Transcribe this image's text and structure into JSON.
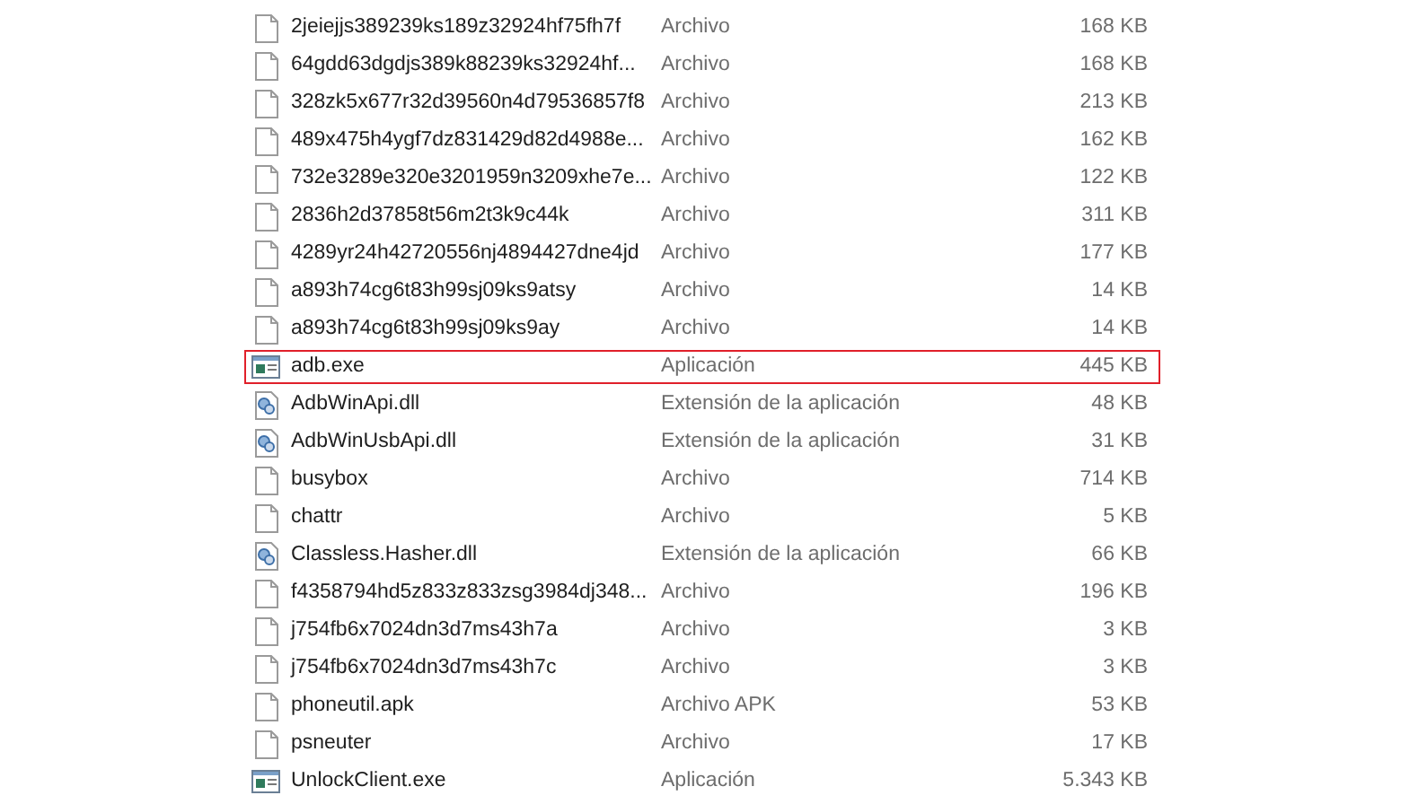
{
  "files": [
    {
      "name": "2jeiejjs389239ks189z32924hf75fh7f",
      "type": "Archivo",
      "size": "168 KB",
      "kind": "file",
      "outlined": false
    },
    {
      "name": "64gdd63dgdjs389k88239ks32924hf...",
      "type": "Archivo",
      "size": "168 KB",
      "kind": "file",
      "outlined": false
    },
    {
      "name": "328zk5x677r32d39560n4d79536857f8",
      "type": "Archivo",
      "size": "213 KB",
      "kind": "file",
      "outlined": false
    },
    {
      "name": "489x475h4ygf7dz831429d82d4988e...",
      "type": "Archivo",
      "size": "162 KB",
      "kind": "file",
      "outlined": false
    },
    {
      "name": "732e3289e320e3201959n3209xhe7e...",
      "type": "Archivo",
      "size": "122 KB",
      "kind": "file",
      "outlined": false
    },
    {
      "name": "2836h2d37858t56m2t3k9c44k",
      "type": "Archivo",
      "size": "311 KB",
      "kind": "file",
      "outlined": false
    },
    {
      "name": "4289yr24h42720556nj4894427dne4jd",
      "type": "Archivo",
      "size": "177 KB",
      "kind": "file",
      "outlined": false
    },
    {
      "name": "a893h74cg6t83h99sj09ks9atsy",
      "type": "Archivo",
      "size": "14 KB",
      "kind": "file",
      "outlined": false
    },
    {
      "name": "a893h74cg6t83h99sj09ks9ay",
      "type": "Archivo",
      "size": "14 KB",
      "kind": "file",
      "outlined": false
    },
    {
      "name": "adb.exe",
      "type": "Aplicación",
      "size": "445 KB",
      "kind": "exe",
      "outlined": true
    },
    {
      "name": "AdbWinApi.dll",
      "type": "Extensión de la aplicación",
      "size": "48 KB",
      "kind": "dll",
      "outlined": false
    },
    {
      "name": "AdbWinUsbApi.dll",
      "type": "Extensión de la aplicación",
      "size": "31 KB",
      "kind": "dll",
      "outlined": false
    },
    {
      "name": "busybox",
      "type": "Archivo",
      "size": "714 KB",
      "kind": "file",
      "outlined": false
    },
    {
      "name": "chattr",
      "type": "Archivo",
      "size": "5 KB",
      "kind": "file",
      "outlined": false
    },
    {
      "name": "Classless.Hasher.dll",
      "type": "Extensión de la aplicación",
      "size": "66 KB",
      "kind": "dll",
      "outlined": false
    },
    {
      "name": "f4358794hd5z833z833zsg3984dj348...",
      "type": "Archivo",
      "size": "196 KB",
      "kind": "file",
      "outlined": false
    },
    {
      "name": "j754fb6x7024dn3d7ms43h7a",
      "type": "Archivo",
      "size": "3 KB",
      "kind": "file",
      "outlined": false
    },
    {
      "name": "j754fb6x7024dn3d7ms43h7c",
      "type": "Archivo",
      "size": "3 KB",
      "kind": "file",
      "outlined": false
    },
    {
      "name": "phoneutil.apk",
      "type": "Archivo APK",
      "size": "53 KB",
      "kind": "file",
      "outlined": false
    },
    {
      "name": "psneuter",
      "type": "Archivo",
      "size": "17 KB",
      "kind": "file",
      "outlined": false
    },
    {
      "name": "UnlockClient.exe",
      "type": "Aplicación",
      "size": "5.343 KB",
      "kind": "exe",
      "outlined": false
    }
  ]
}
